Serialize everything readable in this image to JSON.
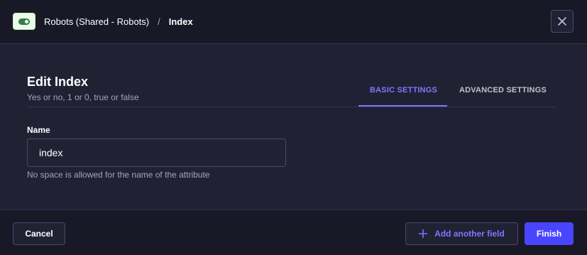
{
  "header": {
    "breadcrumb_parent": "Robots (Shared - Robots)",
    "breadcrumb_separator": "/",
    "breadcrumb_current": "Index",
    "type_icon": "boolean-toggle-icon",
    "close_icon": "close-icon"
  },
  "main": {
    "title": "Edit Index",
    "subtitle": "Yes or no, 1 or 0, true or false",
    "tabs": [
      {
        "label": "BASIC SETTINGS",
        "active": true
      },
      {
        "label": "ADVANCED SETTINGS",
        "active": false
      }
    ],
    "name_field": {
      "label": "Name",
      "value": "index",
      "hint": "No space is allowed for the name of the attribute"
    }
  },
  "footer": {
    "cancel_label": "Cancel",
    "add_field_label": "Add another field",
    "add_field_icon": "plus-icon",
    "finish_label": "Finish"
  },
  "colors": {
    "accent": "#7b79ff",
    "primary_button": "#4945ff",
    "background": "#212134",
    "header_footer": "#181826",
    "boolean_icon_bg": "#eafbe7",
    "boolean_icon_fg": "#328048"
  }
}
